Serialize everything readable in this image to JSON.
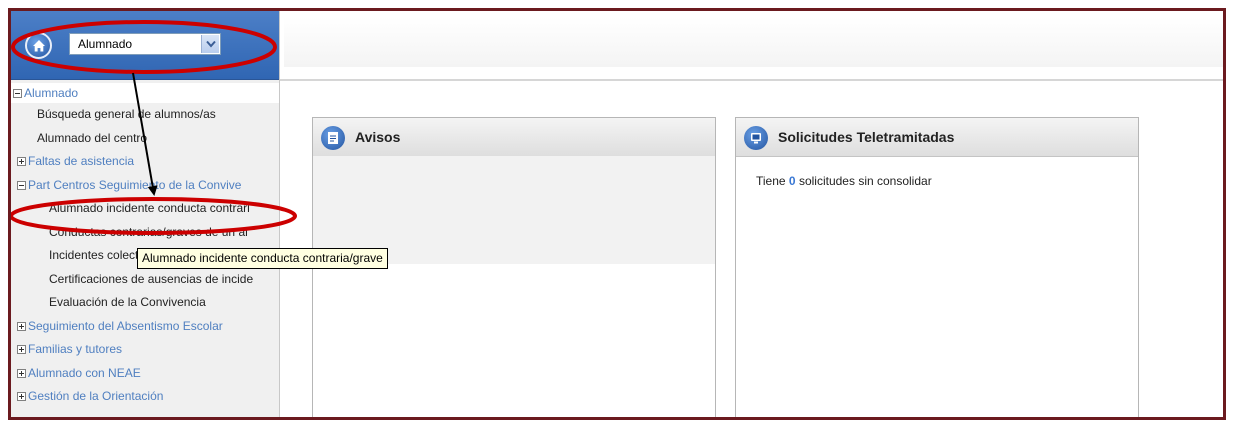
{
  "sidebar": {
    "select_value": "Alumnado",
    "tree": [
      {
        "label": "Alumnado",
        "kind": "root"
      },
      {
        "label": "Búsqueda general de alumnos/as",
        "kind": "leaf"
      },
      {
        "label": "Alumnado del centro",
        "kind": "leaf"
      },
      {
        "label": "Faltas de asistencia",
        "kind": "group"
      },
      {
        "label": "Part Centros Seguimiento de la Convive",
        "kind": "group-open"
      },
      {
        "label": "Alumnado incidente conducta contrari",
        "kind": "subleaf"
      },
      {
        "label": "Conductas contrarias/graves de un al",
        "kind": "subleaf"
      },
      {
        "label": "Incidentes colectivos",
        "kind": "subleaf"
      },
      {
        "label": "Certificaciones de ausencias de incide",
        "kind": "subleaf"
      },
      {
        "label": "Evaluación de la Convivencia",
        "kind": "subleaf"
      },
      {
        "label": "Seguimiento del Absentismo Escolar",
        "kind": "group"
      },
      {
        "label": "Familias y tutores",
        "kind": "group"
      },
      {
        "label": "Alumnado con NEAE",
        "kind": "group"
      },
      {
        "label": "Gestión de la Orientación",
        "kind": "group"
      }
    ]
  },
  "tooltip": {
    "text": "Alumnado incidente conducta contraria/grave"
  },
  "avisos": {
    "title": "Avisos"
  },
  "solicitudes": {
    "title": "Solicitudes Teletramitadas",
    "prefix": "Tiene",
    "count": "0",
    "suffix": "solicitudes sin consolidar"
  },
  "colors": {
    "frame": "#6b1a1f",
    "topbar": "#3a6fbb",
    "link": "#4f7fc0",
    "annotation": "#cc0000"
  },
  "icons": {
    "home": "home-icon",
    "dropdown": "chevron-down-icon",
    "avisos": "document-icon",
    "solicitudes": "monitor-icon"
  }
}
